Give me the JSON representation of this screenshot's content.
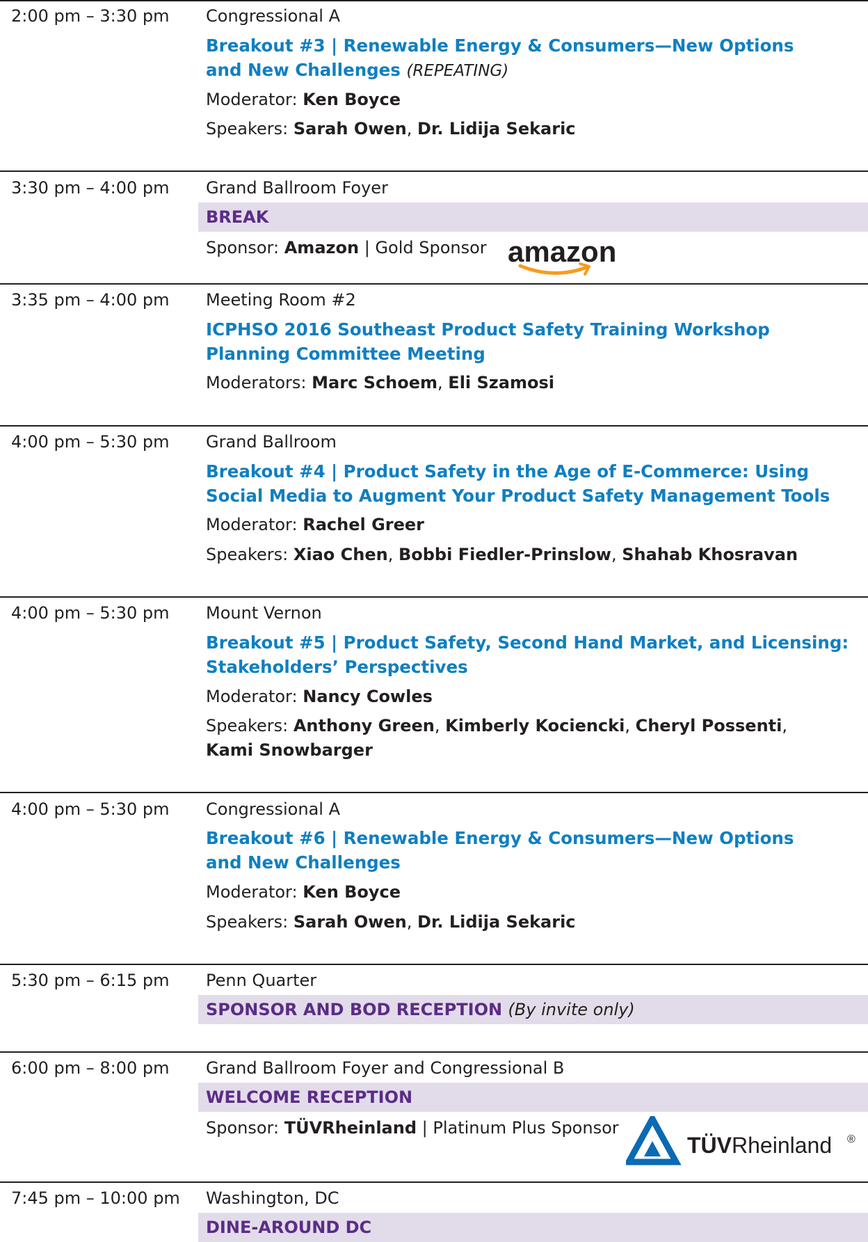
{
  "sessions": [
    {
      "time": "2:00 pm – 3:30 pm",
      "location": "Congressional A",
      "title_1": "Breakout #3 | Renewable Energy & Consumers—New Options",
      "title_2": "and New Challenges",
      "title_note": "(REPEATING)",
      "moderator_label": "Moderator:",
      "moderators": [
        "Ken Boyce"
      ],
      "speakers_label": "Speakers:",
      "speakers": [
        "Sarah Owen",
        "Dr. Lidija Sekaric"
      ]
    },
    {
      "time": "3:30 pm – 4:00 pm",
      "location": "Grand Ballroom Foyer",
      "band_title": "BREAK",
      "sponsor_label": "Sponsor:",
      "sponsor_name": "Amazon",
      "sponsor_level": "| Gold Sponsor",
      "logo_text": "amazon"
    },
    {
      "time": "3:35 pm – 4:00 pm",
      "location": "Meeting Room #2",
      "title_1": "ICPHSO 2016 Southeast Product Safety Training Workshop",
      "title_2": "Planning Committee Meeting",
      "moderator_label": "Moderators:",
      "moderators": [
        "Marc Schoem",
        "Eli Szamosi"
      ]
    },
    {
      "time": "4:00 pm – 5:30 pm",
      "location": "Grand Ballroom",
      "title_1": "Breakout #4 | Product Safety in the Age of E-Commerce: Using",
      "title_2": "Social Media to Augment Your Product Safety Management Tools",
      "moderator_label": "Moderator:",
      "moderators": [
        "Rachel Greer"
      ],
      "speakers_label": "Speakers:",
      "speakers": [
        "Xiao Chen",
        "Bobbi Fiedler-Prinslow",
        "Shahab Khosravan"
      ]
    },
    {
      "time": "4:00 pm – 5:30 pm",
      "location": "Mount Vernon",
      "title_1": "Breakout #5 | Product Safety, Second Hand Market, and Licensing:",
      "title_2": "Stakeholders’ Perspectives",
      "moderator_label": "Moderator:",
      "moderators": [
        "Nancy Cowles"
      ],
      "speakers_label": "Speakers:",
      "speakers": [
        "Anthony Green",
        "Kimberly Kociencki",
        "Cheryl Possenti",
        "Kami Snowbarger"
      ]
    },
    {
      "time": "4:00 pm – 5:30 pm",
      "location": "Congressional A",
      "title_1": "Breakout #6 | Renewable Energy & Consumers—New Options",
      "title_2": "and New Challenges",
      "moderator_label": "Moderator:",
      "moderators": [
        "Ken Boyce"
      ],
      "speakers_label": "Speakers:",
      "speakers": [
        "Sarah Owen",
        "Dr. Lidija Sekaric"
      ]
    },
    {
      "time": "5:30 pm – 6:15 pm",
      "location": "Penn Quarter",
      "band_title": "SPONSOR AND BOD RECEPTION",
      "band_note": "(By invite only)"
    },
    {
      "time": "6:00 pm – 8:00 pm",
      "location": "Grand Ballroom Foyer and Congressional B",
      "band_title": "WELCOME RECEPTION",
      "sponsor_label": "Sponsor:",
      "sponsor_name": "TÜVRheinland",
      "sponsor_level": "| Platinum Plus Sponsor",
      "logo_text_bold": "TÜV",
      "logo_text_light": "Rheinland",
      "logo_mark": "®"
    },
    {
      "time": "7:45 pm – 10:00 pm",
      "location": "Washington, DC",
      "band_title": "DINE-AROUND DC"
    }
  ],
  "colors": {
    "title_blue": "#0f7fc1",
    "band_purple": "#5b2c86",
    "band_bg": "#e2dcea",
    "text": "#231f20",
    "amazon_orange": "#f79c1c",
    "tuv_blue": "#0a6ab3"
  }
}
